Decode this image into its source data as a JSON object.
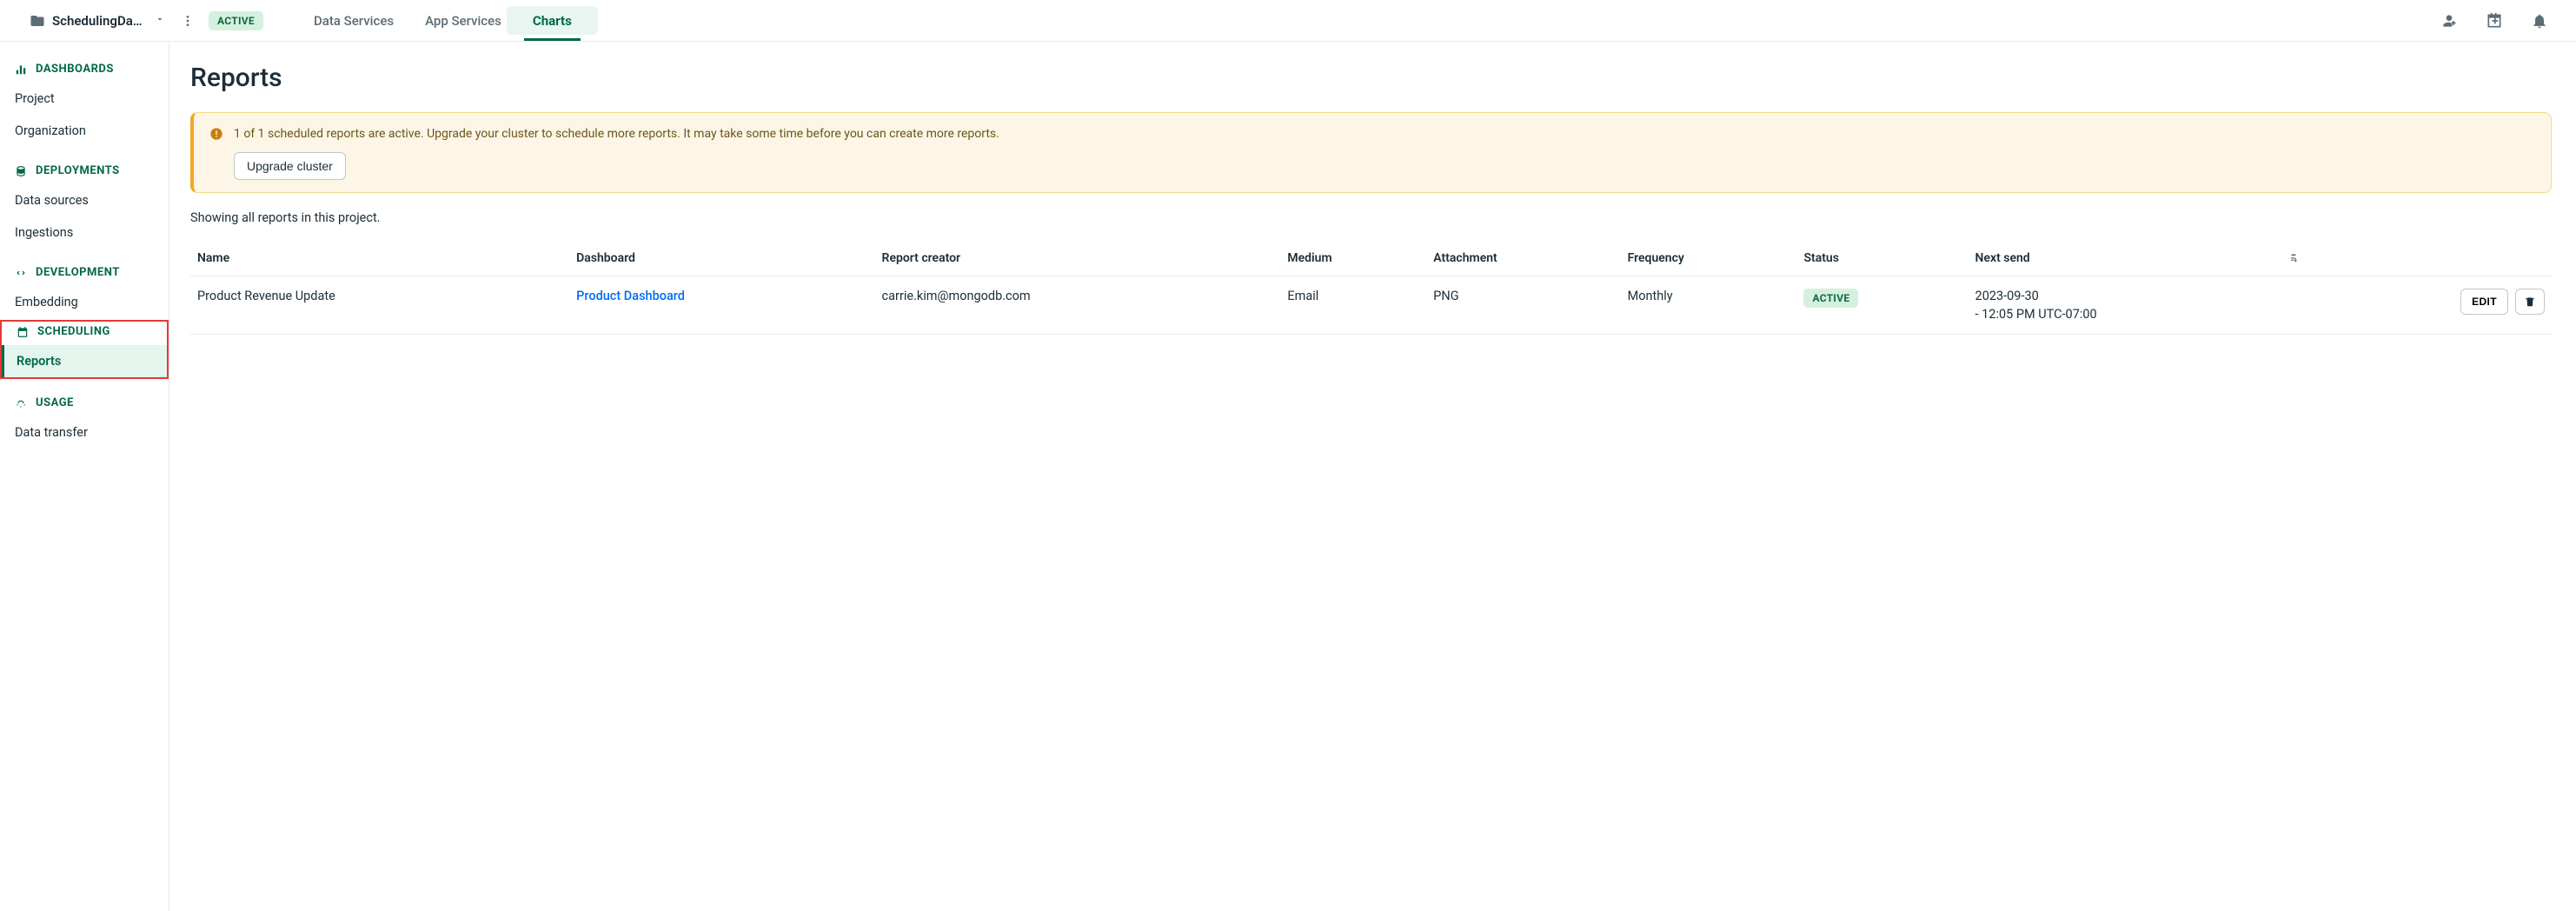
{
  "header": {
    "project_name": "SchedulingDas…",
    "status_badge": "ACTIVE",
    "tabs": {
      "data_services": "Data Services",
      "app_services": "App Services",
      "charts": "Charts"
    }
  },
  "sidebar": {
    "dashboards": {
      "header": "DASHBOARDS",
      "items": {
        "project": "Project",
        "organization": "Organization"
      }
    },
    "deployments": {
      "header": "DEPLOYMENTS",
      "items": {
        "data_sources": "Data sources",
        "ingestions": "Ingestions"
      }
    },
    "development": {
      "header": "DEVELOPMENT",
      "items": {
        "embedding": "Embedding"
      }
    },
    "scheduling": {
      "header": "SCHEDULING",
      "items": {
        "reports": "Reports"
      }
    },
    "usage": {
      "header": "USAGE",
      "items": {
        "data_transfer": "Data transfer"
      }
    }
  },
  "page": {
    "title": "Reports",
    "banner": {
      "text": "1 of 1 scheduled reports are active. Upgrade your cluster to schedule more reports. It may take some time before you can create more reports.",
      "button": "Upgrade cluster"
    },
    "subtext": "Showing all reports in this project.",
    "columns": {
      "name": "Name",
      "dashboard": "Dashboard",
      "creator": "Report creator",
      "medium": "Medium",
      "attachment": "Attachment",
      "frequency": "Frequency",
      "status": "Status",
      "next_send": "Next send"
    },
    "rows": [
      {
        "name": "Product Revenue Update",
        "dashboard": "Product Dashboard",
        "creator": "carrie.kim@mongodb.com",
        "medium": "Email",
        "attachment": "PNG",
        "frequency": "Monthly",
        "status": "ACTIVE",
        "next_send_date": "2023-09-30",
        "next_send_time": "- 12:05 PM UTC-07:00",
        "edit_label": "EDIT"
      }
    ]
  }
}
